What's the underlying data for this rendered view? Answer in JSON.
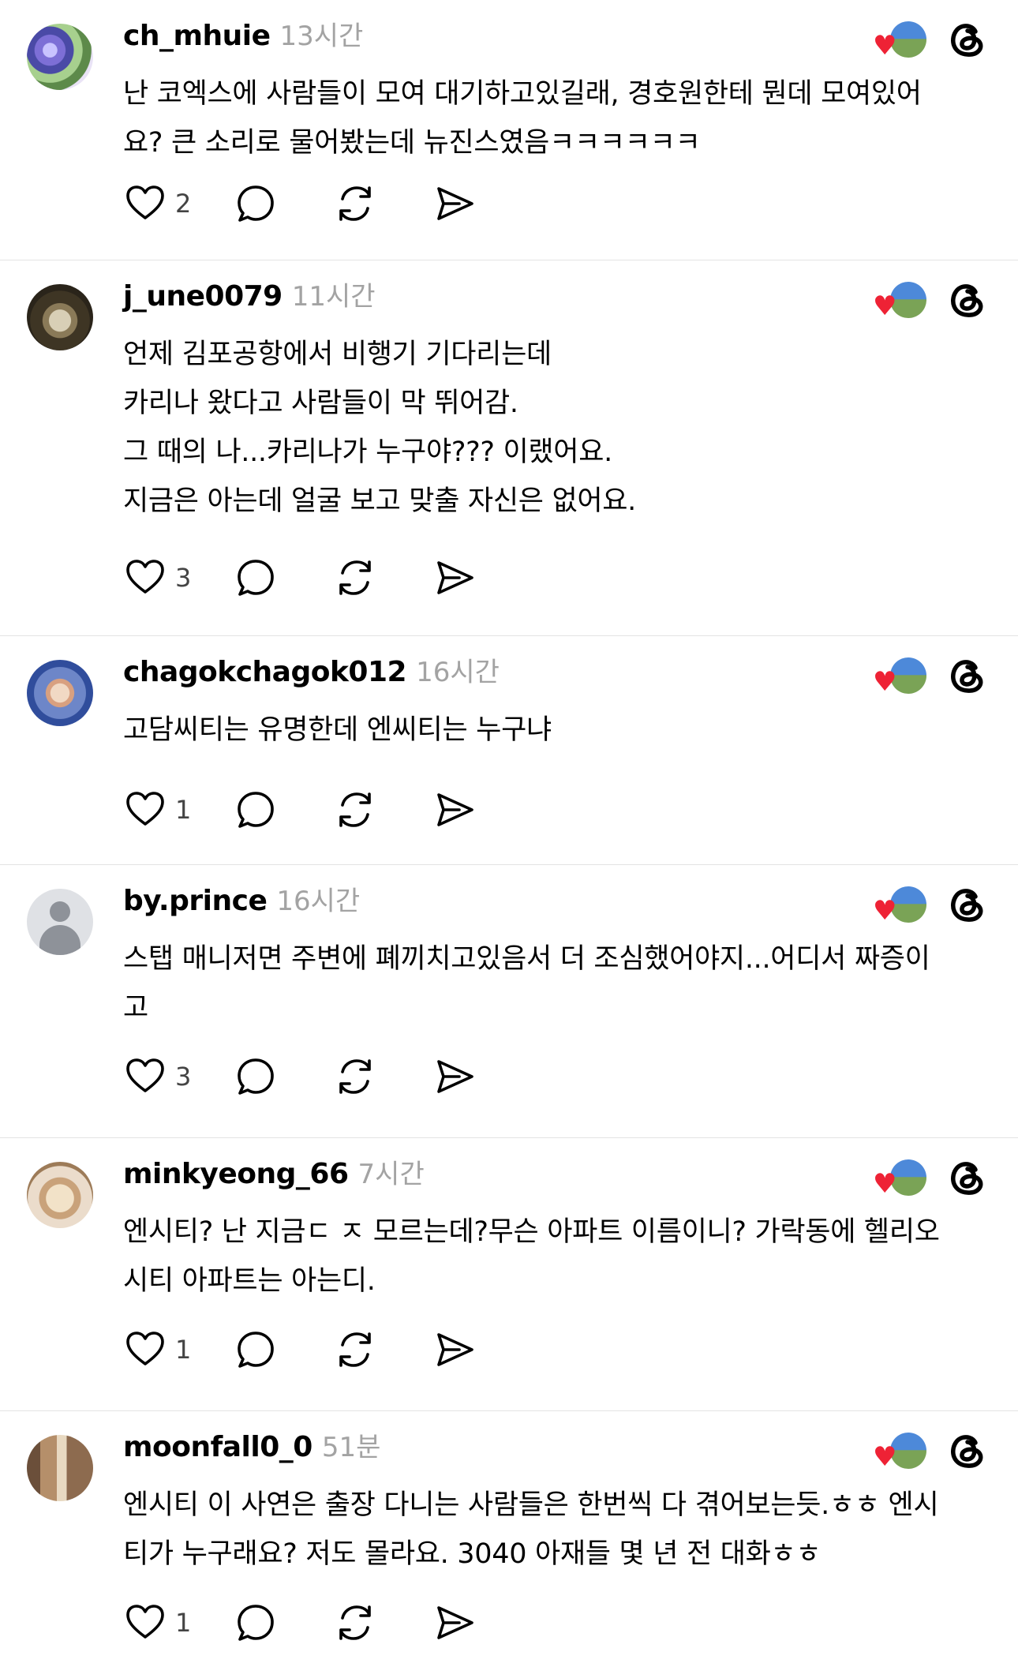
{
  "posts": [
    {
      "username": "ch_mhuie",
      "time": "13시간",
      "lines": [
        "난 코엑스에 사람들이 모여 대기하고있길래, 경호원한테 뭔데 모여있어",
        "요? 큰 소리로 물어봤는데 뉴진스였음ㅋㅋㅋㅋㅋㅋ"
      ],
      "likes": "2",
      "avatar_icon": "flower-photo"
    },
    {
      "username": "j_une0079",
      "time": "11시간",
      "lines": [
        "언제 김포공항에서 비행기 기다리는데",
        "카리나 왔다고 사람들이 막 뛰어감.",
        "그 때의 나...카리나가 누구야??? 이랬어요.",
        "지금은 아는데 얼굴 보고 맞출 자신은 없어요."
      ],
      "likes": "3",
      "avatar_icon": "coffee-cup-photo"
    },
    {
      "username": "chagokchagok012",
      "time": "16시간",
      "lines": [
        "고담씨티는 유명한데 엔씨티는 누구냐"
      ],
      "likes": "1",
      "avatar_icon": "cartoon-photo"
    },
    {
      "username": "by.prince",
      "time": "16시간",
      "lines": [
        "스탭 매니저면 주변에 폐끼치고있음서 더 조심했어야지...어디서 짜증이",
        "고"
      ],
      "likes": "3",
      "avatar_icon": "default-person"
    },
    {
      "username": "minkyeong_66",
      "time": "7시간",
      "lines": [
        "엔시티? 난 지금ㄷ ㅈ 모르는데?무슨 아파트 이름이니? 가락동에 헬리오",
        "시티 아파트는 아는디."
      ],
      "likes": "1",
      "avatar_icon": "dog-photo"
    },
    {
      "username": "moonfall0_0",
      "time": "51분",
      "lines": [
        "엔시티 이 사연은 출장 다니는 사람들은 한번씩 다 겪어보는듯.ㅎㅎ 엔시",
        "티가 누구래요? 저도 몰라요. 3040 아재들 몇 년 전 대화ㅎㅎ"
      ],
      "likes": "1",
      "avatar_icon": "door-photo"
    }
  ],
  "icons": {
    "like": "heart-outline-icon",
    "comment": "speech-bubble-icon",
    "repost": "repost-arrows-icon",
    "share": "paper-plane-icon",
    "liked_by_author": "heart-avatar-badge",
    "threads": "threads-logo-icon"
  },
  "colors": {
    "background": "#ffffff",
    "username": "#000000",
    "timestamp": "#a3a3a3",
    "divider": "#e3e3e3",
    "heart_badge": "#ee2235"
  }
}
